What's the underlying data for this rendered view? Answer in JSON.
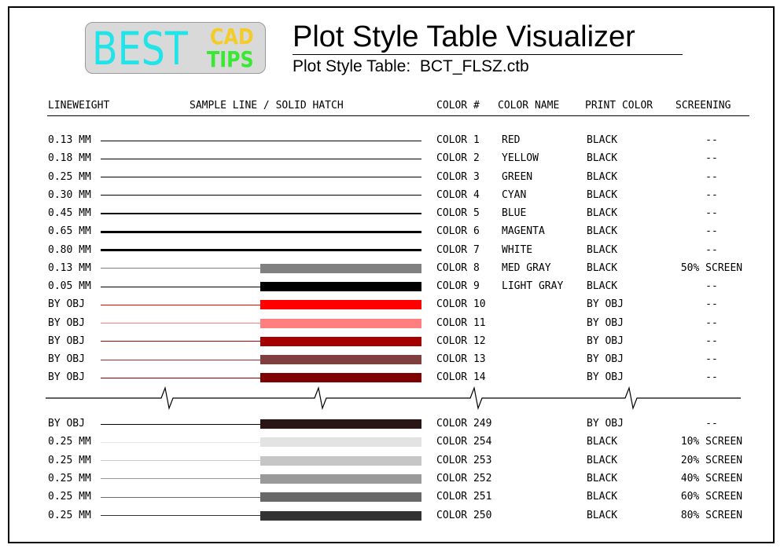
{
  "logo": {
    "best": "BEST",
    "cad": "CAD",
    "tips": "TIPS"
  },
  "title": "Plot Style Table Visualizer",
  "subtitle": "Plot Style Table:  BCT_FLSZ.ctb",
  "headers": {
    "lineweight": "LINEWEIGHT",
    "sample": "SAMPLE LINE / SOLID HATCH",
    "color_num": "COLOR #",
    "color_name": "COLOR NAME",
    "print_color": "PRINT COLOR",
    "screening": "SCREENING"
  },
  "rows_top": [
    {
      "lineweight": "0.13 MM",
      "color": "COLOR 1",
      "name": "RED",
      "print": "BLACK",
      "screening": "--",
      "line_color": "#000000",
      "weight": 1,
      "hatch": ""
    },
    {
      "lineweight": "0.18 MM",
      "color": "COLOR 2",
      "name": "YELLOW",
      "print": "BLACK",
      "screening": "--",
      "line_color": "#000000",
      "weight": 1,
      "hatch": ""
    },
    {
      "lineweight": "0.25 MM",
      "color": "COLOR 3",
      "name": "GREEN",
      "print": "BLACK",
      "screening": "--",
      "line_color": "#000000",
      "weight": 1.2,
      "hatch": ""
    },
    {
      "lineweight": "0.30 MM",
      "color": "COLOR 4",
      "name": "CYAN",
      "print": "BLACK",
      "screening": "--",
      "line_color": "#000000",
      "weight": 1.4,
      "hatch": ""
    },
    {
      "lineweight": "0.45 MM",
      "color": "COLOR 5",
      "name": "BLUE",
      "print": "BLACK",
      "screening": "--",
      "line_color": "#000000",
      "weight": 2.4,
      "hatch": ""
    },
    {
      "lineweight": "0.65 MM",
      "color": "COLOR 6",
      "name": "MAGENTA",
      "print": "BLACK",
      "screening": "--",
      "line_color": "#000000",
      "weight": 3,
      "hatch": ""
    },
    {
      "lineweight": "0.80 MM",
      "color": "COLOR 7",
      "name": "WHITE",
      "print": "BLACK",
      "screening": "--",
      "line_color": "#000000",
      "weight": 3.4,
      "hatch": ""
    },
    {
      "lineweight": "0.13 MM",
      "color": "COLOR 8",
      "name": "MED GRAY",
      "print": "BLACK",
      "screening": "50% SCREEN",
      "line_color": "#808080",
      "weight": 1,
      "hatch": "#808080"
    },
    {
      "lineweight": "0.05 MM",
      "color": "COLOR 9",
      "name": "LIGHT GRAY",
      "print": "BLACK",
      "screening": "--",
      "line_color": "#000000",
      "weight": 1,
      "hatch": "#000000"
    },
    {
      "lineweight": "BY OBJ",
      "color": "COLOR 10",
      "name": "",
      "print": "BY OBJ",
      "screening": "--",
      "line_color": "#ff0000",
      "weight": 1,
      "hatch": "#ff0000"
    },
    {
      "lineweight": "BY OBJ",
      "color": "COLOR 11",
      "name": "",
      "print": "BY OBJ",
      "screening": "--",
      "line_color": "#ff7f7f",
      "weight": 1,
      "hatch": "#ff7f7f"
    },
    {
      "lineweight": "BY OBJ",
      "color": "COLOR 12",
      "name": "",
      "print": "BY OBJ",
      "screening": "--",
      "line_color": "#a50000",
      "weight": 1,
      "hatch": "#a50000"
    },
    {
      "lineweight": "BY OBJ",
      "color": "COLOR 13",
      "name": "",
      "print": "BY OBJ",
      "screening": "--",
      "line_color": "#a52929",
      "weight": 1,
      "hatch": "#7f3f3f"
    },
    {
      "lineweight": "BY OBJ",
      "color": "COLOR 14",
      "name": "",
      "print": "BY OBJ",
      "screening": "--",
      "line_color": "#7f0000",
      "weight": 1,
      "hatch": "#7f0000"
    }
  ],
  "rows_bottom": [
    {
      "lineweight": "BY OBJ",
      "color": "COLOR 249",
      "name": "",
      "print": "BY OBJ",
      "screening": "--",
      "line_color": "#000000",
      "weight": 1,
      "hatch": "#2a1515"
    },
    {
      "lineweight": "0.25 MM",
      "color": "COLOR 254",
      "name": "",
      "print": "BLACK",
      "screening": "10% SCREEN",
      "line_color": "#e6e6e6",
      "weight": 1,
      "hatch": "#e3e3e3"
    },
    {
      "lineweight": "0.25 MM",
      "color": "COLOR 253",
      "name": "",
      "print": "BLACK",
      "screening": "20% SCREEN",
      "line_color": "#c8c8c8",
      "weight": 1,
      "hatch": "#c6c6c6"
    },
    {
      "lineweight": "0.25 MM",
      "color": "COLOR 252",
      "name": "",
      "print": "BLACK",
      "screening": "40% SCREEN",
      "line_color": "#999999",
      "weight": 1,
      "hatch": "#9a9a9a"
    },
    {
      "lineweight": "0.25 MM",
      "color": "COLOR 251",
      "name": "",
      "print": "BLACK",
      "screening": "60% SCREEN",
      "line_color": "#6a6a6a",
      "weight": 1,
      "hatch": "#686868"
    },
    {
      "lineweight": "0.25 MM",
      "color": "COLOR 250",
      "name": "",
      "print": "BLACK",
      "screening": "80% SCREEN",
      "line_color": "#333333",
      "weight": 1,
      "hatch": "#333333"
    }
  ]
}
